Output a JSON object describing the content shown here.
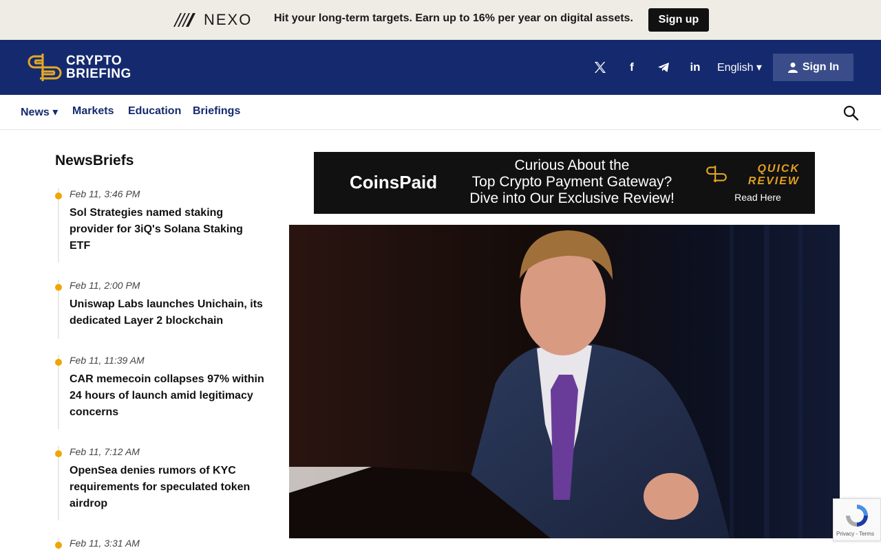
{
  "promo": {
    "brand": "NEXO",
    "text": "Hit your long-term targets. Earn up to 16% per year on digital assets.",
    "button": "Sign up"
  },
  "header": {
    "logo_line1": "CRYPTO",
    "logo_line2": "BRIEFING",
    "social": [
      "x-icon",
      "facebook-icon",
      "telegram-icon",
      "linkedin-icon"
    ],
    "language": "English ▾",
    "signin": "Sign In"
  },
  "nav": {
    "items": [
      "News ▾",
      "Markets",
      "Education",
      "Briefings"
    ]
  },
  "sidebar": {
    "title": "NewsBriefs",
    "items": [
      {
        "time": "Feb 11, 3:46 PM",
        "headline": "Sol Strategies named staking provider for 3iQ's Solana Staking ETF"
      },
      {
        "time": "Feb 11, 2:00 PM",
        "headline": "Uniswap Labs launches Unichain, its dedicated Layer 2 blockchain"
      },
      {
        "time": "Feb 11, 11:39 AM",
        "headline": "CAR memecoin collapses 97% within 24 hours of launch amid legitimacy concerns"
      },
      {
        "time": "Feb 11, 7:12 AM",
        "headline": "OpenSea denies rumors of KYC requirements for speculated token airdrop"
      },
      {
        "time": "Feb 11, 3:31 AM",
        "headline": ""
      }
    ]
  },
  "ad": {
    "brand": "CoinsPaid",
    "line1": "Curious About the",
    "line2": "Top Crypto Payment Gateway?",
    "line3": "Dive into Our Exclusive Review!",
    "badge_line1": "QUICK",
    "badge_line2": "REVIEW",
    "cta": "Read Here"
  },
  "recaptcha": {
    "text": "Privacy - Terms"
  },
  "colors": {
    "header_bg": "#152a6e",
    "accent": "#f0a500",
    "promo_bg": "#efece6"
  }
}
